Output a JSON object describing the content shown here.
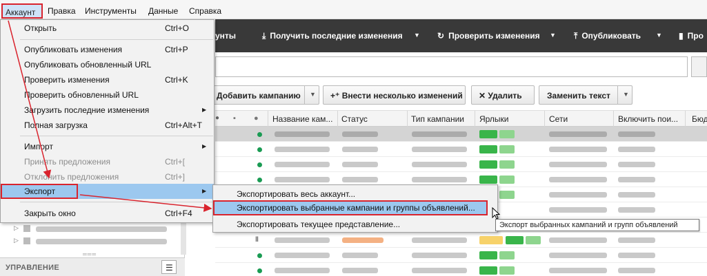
{
  "menubar": {
    "items": [
      "Аккаунт",
      "Правка",
      "Инструменты",
      "Данные",
      "Справка"
    ]
  },
  "toolbar": {
    "accounts_label": "унты",
    "get_changes_label": "Получить последние изменения",
    "check_changes_label": "Проверить изменения",
    "publish_label": "Опубликовать",
    "stats_label": "Про"
  },
  "actions": {
    "add_campaign": "Добавить кампанию",
    "bulk_changes": "Внести несколько изменений",
    "delete": "Удалить",
    "replace_text": "Заменить текст"
  },
  "table": {
    "headers": [
      "Название кам...",
      "Статус",
      "Тип кампании",
      "Ярлыки",
      "Сети",
      "Включить пои...",
      "Бюд"
    ]
  },
  "account_menu": {
    "items": [
      {
        "label": "Открыть",
        "shortcut": "Ctrl+O"
      },
      {
        "label": "Опубликовать изменения",
        "shortcut": "Ctrl+P"
      },
      {
        "label": "Опубликовать обновленный URL",
        "shortcut": ""
      },
      {
        "label": "Проверить изменения",
        "shortcut": "Ctrl+K"
      },
      {
        "label": "Проверить обновленный URL",
        "shortcut": ""
      },
      {
        "label": "Загрузить последние изменения",
        "shortcut": ""
      },
      {
        "label": "Полная загрузка",
        "shortcut": "Ctrl+Alt+T"
      },
      {
        "label": "Импорт",
        "shortcut": ""
      },
      {
        "label": "Принять предложения",
        "shortcut": "Ctrl+["
      },
      {
        "label": "Отклонить предложения",
        "shortcut": "Ctrl+]"
      },
      {
        "label": "Экспорт",
        "shortcut": ""
      },
      {
        "label": "Закрыть окно",
        "shortcut": "Ctrl+F4"
      }
    ]
  },
  "export_submenu": {
    "items": [
      "Экспортировать весь аккаунт...",
      "Экспортировать выбранные кампании и группы объявлений...",
      "Экспортировать текущее представление..."
    ]
  },
  "tooltip": "Экспорт выбранных кампаний и групп объявлений",
  "left_panel": {
    "management_label": "УПРАВЛЕНИЕ"
  },
  "colors": {
    "highlight_red": "#d9232d",
    "menu_highlight": "#9cc8ef",
    "toolbar_bg": "#393939",
    "label_green": "#39b54a"
  },
  "icons": {
    "get_changes": "download-icon",
    "check_changes": "refresh-icon",
    "publish": "upload-icon",
    "stats": "bar-chart-icon",
    "filter": "filter-icon"
  }
}
